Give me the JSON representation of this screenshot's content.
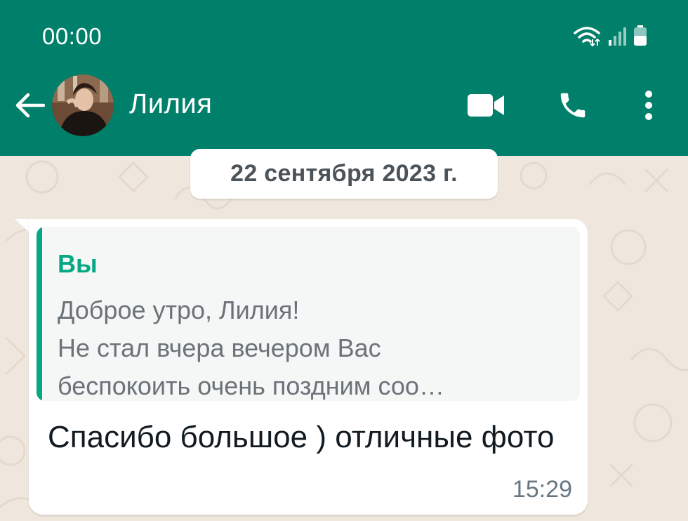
{
  "status_bar": {
    "time": "00:00",
    "icons": [
      "wifi-icon",
      "signal-icon",
      "battery-icon"
    ]
  },
  "header": {
    "back_icon": "arrow-left-icon",
    "contact_name": "Лилия",
    "actions": [
      "video-call-icon",
      "voice-call-icon",
      "more-vert-icon"
    ]
  },
  "chat": {
    "date_label": "22 сентября 2023 г.",
    "message": {
      "quoted": {
        "author": "Вы",
        "text": "Доброе утро, Лилия!\nНе стал вчера вечером Вас\nбеспокоить очень поздним соо…"
      },
      "text": "Спасибо большое ) отличные фото",
      "time": "15:29"
    }
  },
  "colors": {
    "header_bg": "#00806a",
    "chat_bg": "#efe7de",
    "accent": "#06a884",
    "bubble_bg": "#ffffff"
  }
}
